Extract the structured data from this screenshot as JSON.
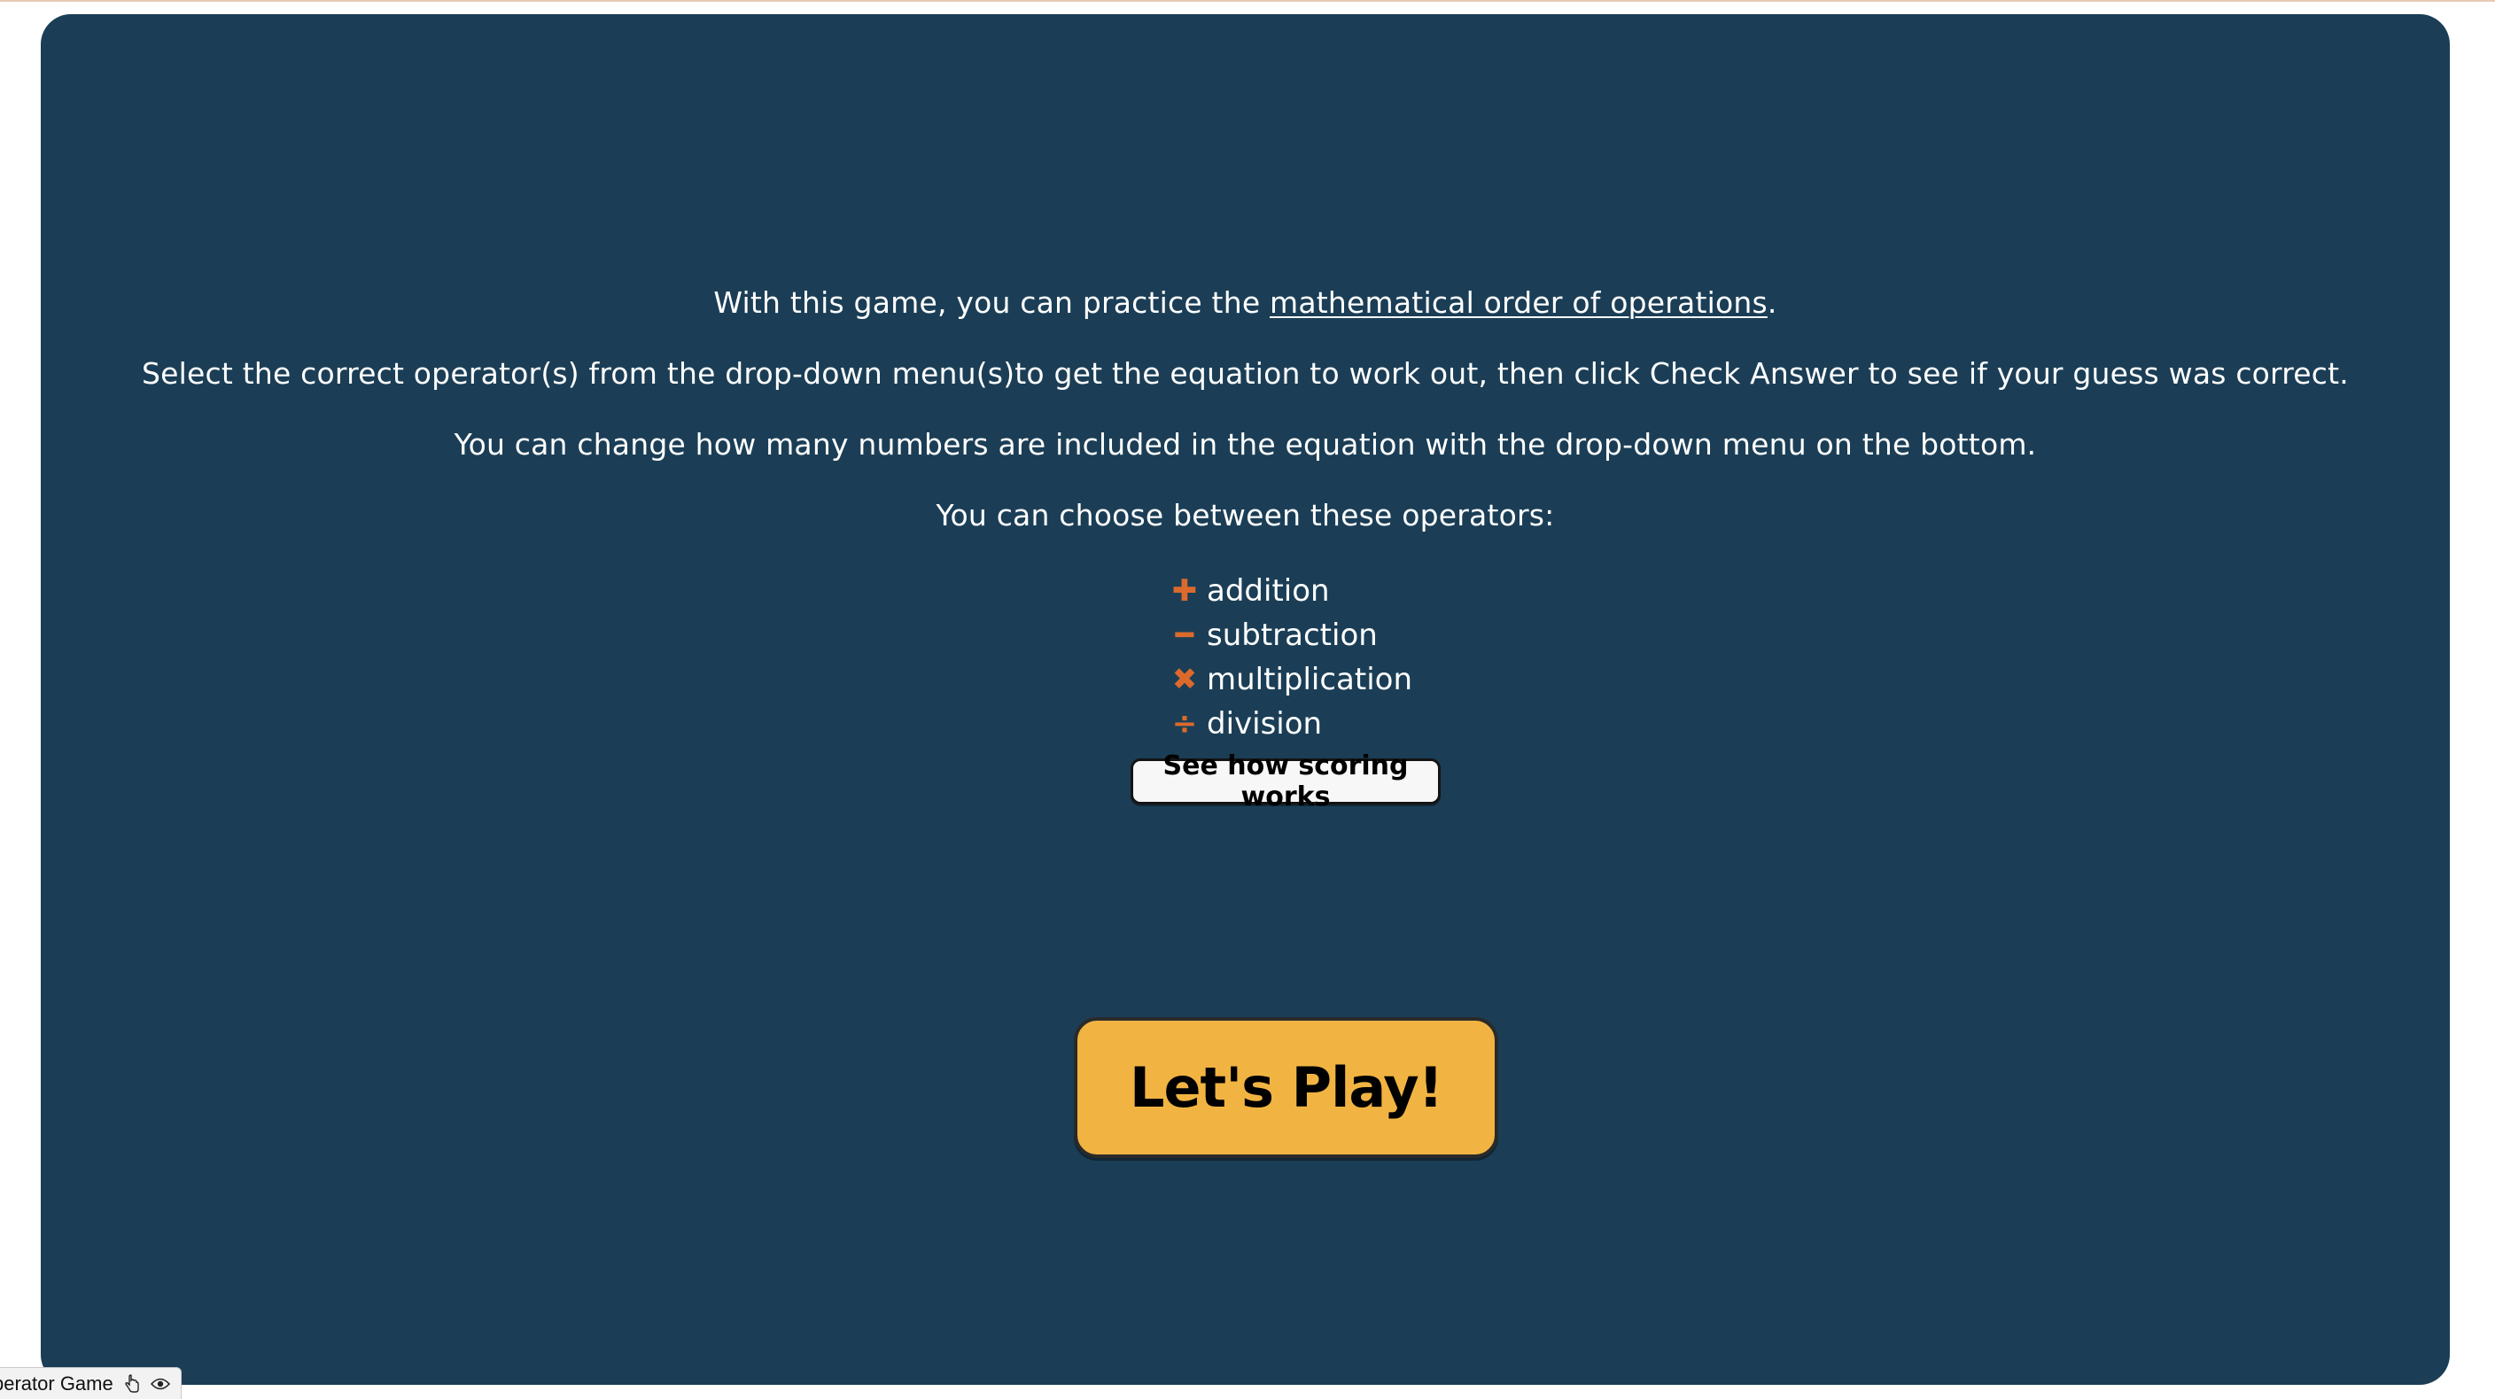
{
  "intro": {
    "line1_prefix": "With this game, you can practice the ",
    "line1_link": "mathematical order of operations",
    "line1_suffix": ".",
    "line2": "Select the correct operator(s) from the drop-down menu(s)to get the equation to work out, then click Check Answer to see if your guess was correct.",
    "line3": "You can change how many numbers are included in the equation with the drop-down menu on the bottom.",
    "line4": "You can choose between these operators:"
  },
  "operators": [
    {
      "symbol": "✚",
      "icon": "plus-icon",
      "label": "addition"
    },
    {
      "symbol": "━",
      "icon": "minus-icon",
      "label": "subtraction"
    },
    {
      "symbol": "✖",
      "icon": "multiply-icon",
      "label": "multiplication"
    },
    {
      "symbol": "÷",
      "icon": "divide-icon",
      "label": "division"
    }
  ],
  "buttons": {
    "scoring": "See how scoring works",
    "play": "Let's Play!"
  },
  "tab": {
    "label": "perator Game"
  },
  "colors": {
    "panel": "#1b3e56",
    "accent": "#dc6a2c",
    "play_button": "#f1b442"
  }
}
